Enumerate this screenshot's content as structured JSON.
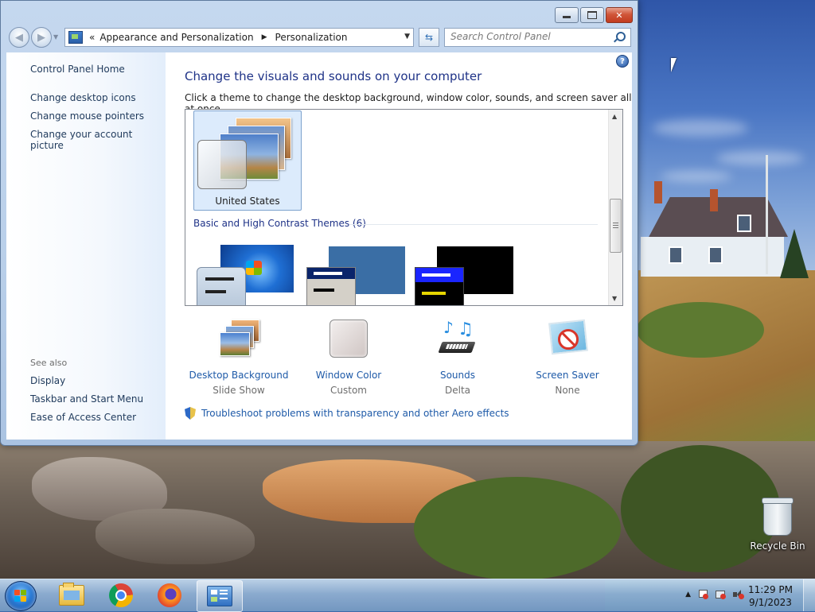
{
  "window": {
    "title": "Personalization",
    "controls": {
      "minimize": "",
      "maximize": "",
      "close": "✕"
    }
  },
  "nav": {
    "back_icon": "back-arrow-icon",
    "forward_icon": "forward-arrow-icon",
    "breadcrumb_overflow": "«",
    "breadcrumb": [
      "Appearance and Personalization",
      "Personalization"
    ],
    "search_placeholder": "Search Control Panel"
  },
  "sidebar": {
    "home": "Control Panel Home",
    "links": [
      "Change desktop icons",
      "Change mouse pointers",
      "Change your account picture"
    ],
    "see_also_label": "See also",
    "see_also": [
      "Display",
      "Taskbar and Start Menu",
      "Ease of Access Center"
    ]
  },
  "main": {
    "heading": "Change the visuals and sounds on your computer",
    "subheading": "Click a theme to change the desktop background, window color, sounds, and screen saver all at once.",
    "selected_theme": "United States",
    "group_title": "Basic and High Contrast Themes (6)",
    "tiles": [
      {
        "title": "Desktop Background",
        "value": "Slide Show",
        "icon": "photos-icon"
      },
      {
        "title": "Window Color",
        "value": "Custom",
        "icon": "window-color-icon"
      },
      {
        "title": "Sounds",
        "value": "Delta",
        "icon": "music-notes-icon"
      },
      {
        "title": "Screen Saver",
        "value": "None",
        "icon": "screen-saver-icon"
      }
    ],
    "troubleshoot": "Troubleshoot problems with transparency and other Aero effects",
    "help": "?"
  },
  "desktop": {
    "recycle_bin": "Recycle Bin"
  },
  "taskbar": {
    "apps": [
      "file-explorer",
      "google-chrome",
      "firefox",
      "control-panel"
    ],
    "active_app": "control-panel",
    "clock_time": "11:29 PM",
    "clock_date": "9/1/2023"
  },
  "colors": {
    "link": "#1e5aa8",
    "heading": "#1e3287",
    "sidebar_link": "#1e395b",
    "selected_theme_bg": "#dcebfc"
  }
}
